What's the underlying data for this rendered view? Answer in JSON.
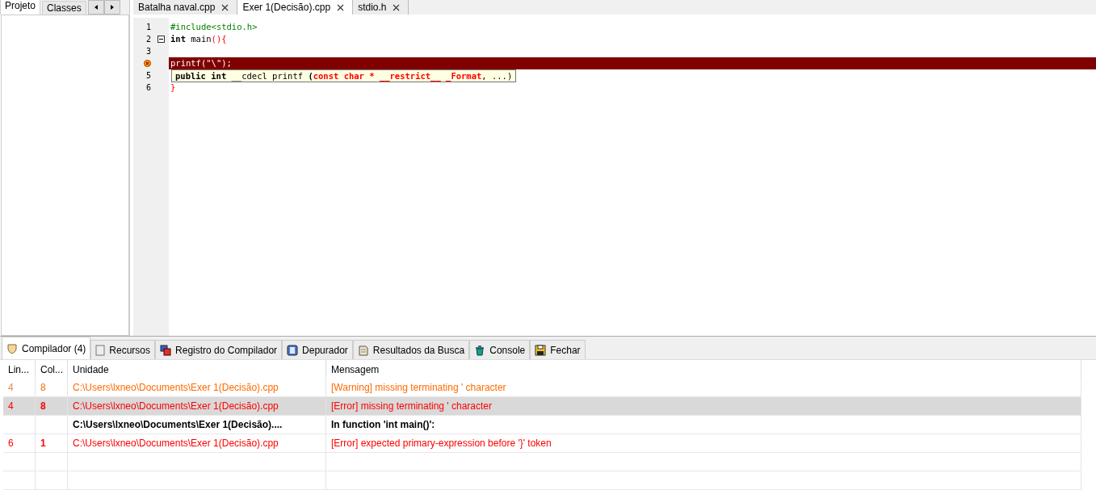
{
  "left_panel": {
    "tabs": [
      {
        "label": "Projeto",
        "selected": true
      },
      {
        "label": "Classes",
        "selected": false
      }
    ]
  },
  "editor": {
    "tabs": [
      {
        "label": "Batalha naval.cpp",
        "selected": false
      },
      {
        "label": "Exer 1(Decisão).cpp",
        "selected": true
      },
      {
        "label": "stdio.h",
        "selected": false
      }
    ],
    "lines": [
      {
        "kind": "code",
        "number": "1",
        "tokens": [
          {
            "kind": "directive",
            "text": "#include<stdio.h>"
          }
        ]
      },
      {
        "kind": "code",
        "number": "2",
        "fold": true,
        "tokens": [
          {
            "kind": "keyword",
            "text": "int"
          },
          {
            "kind": "plain",
            "text": " main"
          },
          {
            "kind": "symbol",
            "text": "(){"
          }
        ]
      },
      {
        "kind": "code",
        "number": "3"
      },
      {
        "kind": "error",
        "highlighted": true,
        "tokens": [
          {
            "kind": "plain",
            "text": "printf(\"\\\");"
          }
        ]
      },
      {
        "kind": "code",
        "number": "5"
      },
      {
        "kind": "code",
        "number": "6",
        "tokens": [
          {
            "kind": "symbol",
            "text": "}"
          }
        ]
      }
    ],
    "tooltip": [
      {
        "kind": "keyword",
        "text": "public int"
      },
      {
        "kind": "plain",
        "text": " __cdecl printf "
      },
      {
        "kind": "keyword",
        "text": "("
      },
      {
        "kind": "param",
        "text": "const char * __restrict__ _Format"
      },
      {
        "kind": "plain",
        "text": ", ...)"
      }
    ]
  },
  "bottom_tabs": [
    {
      "label": "Compilador (4)",
      "selected": true
    },
    {
      "label": "Recursos",
      "selected": false
    },
    {
      "label": "Registro do Compilador",
      "selected": false
    },
    {
      "label": "Depurador",
      "selected": false
    },
    {
      "label": "Resultados da Busca",
      "selected": false
    },
    {
      "label": "Console",
      "selected": false
    },
    {
      "label": "Fechar",
      "selected": false
    }
  ],
  "table": {
    "columns": [
      "Lin...",
      "Col...",
      "Unidade",
      "Mensagem"
    ],
    "rows": [
      {
        "kind": "warning",
        "selected": false,
        "line": "4",
        "col": "8",
        "unit": "C:\\Users\\lxneo\\Documents\\Exer 1(Decisão).cpp",
        "message": "[Warning] missing terminating ' character"
      },
      {
        "kind": "error",
        "selected": true,
        "line": "4",
        "col": "8",
        "unit": "C:\\Users\\lxneo\\Documents\\Exer 1(Decisão).cpp",
        "message": "[Error] missing terminating ' character"
      },
      {
        "kind": "context",
        "selected": false,
        "unit": "C:\\Users\\lxneo\\Documents\\Exer 1(Decisão)....",
        "message": "In function 'int main()':"
      },
      {
        "kind": "error",
        "selected": false,
        "line": "6",
        "col": "1",
        "unit": "C:\\Users\\lxneo\\Documents\\Exer 1(Decisão).cpp",
        "message": "[Error] expected primary-expression before '}' token"
      }
    ]
  }
}
